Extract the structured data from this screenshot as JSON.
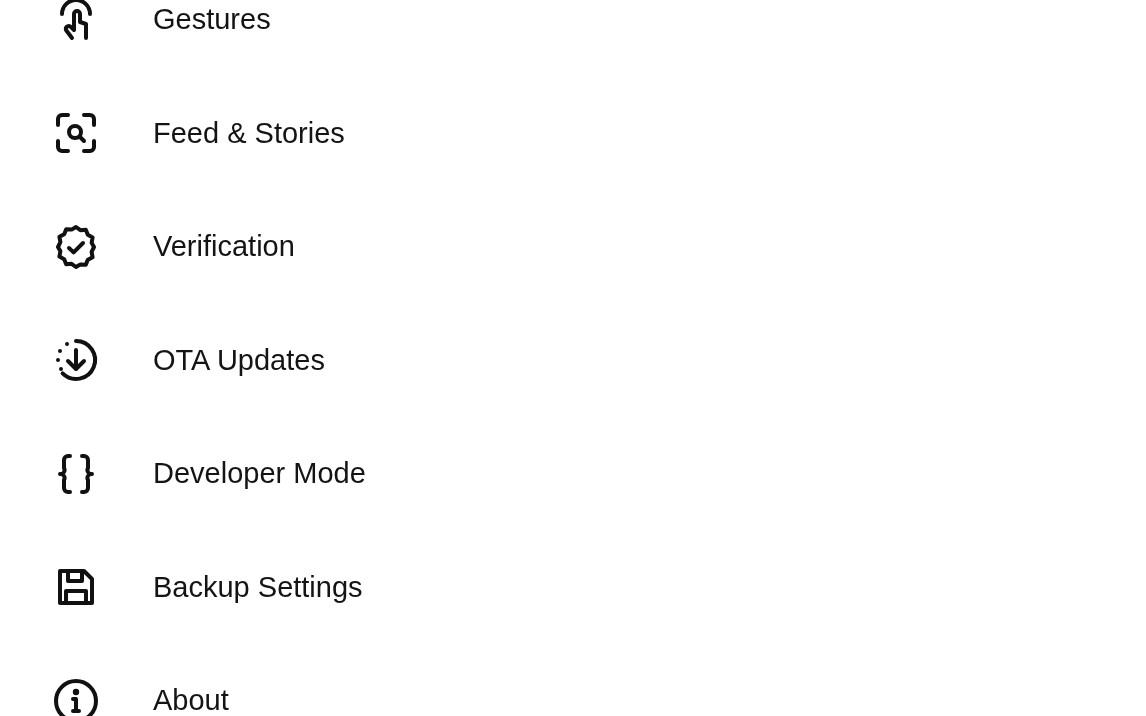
{
  "settings_items": [
    {
      "kind": "gestures",
      "label": "Gestures"
    },
    {
      "kind": "feed",
      "label": "Feed & Stories"
    },
    {
      "kind": "verification",
      "label": "Verification"
    },
    {
      "kind": "updates",
      "label": "OTA Updates"
    },
    {
      "kind": "developer",
      "label": "Developer Mode"
    },
    {
      "kind": "backup",
      "label": "Backup Settings"
    },
    {
      "kind": "about",
      "label": "About"
    }
  ]
}
